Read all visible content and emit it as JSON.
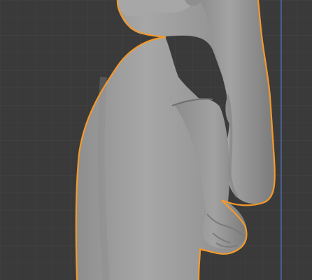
{
  "viewport": {
    "background": "#3a3a3a",
    "grid_color": "#444444",
    "axis_line_color": "#4d6fb3",
    "selection_outline_color": "#f39a2b",
    "mesh_base_color": "#9a9a9a",
    "icon_names": [
      "3d-viewport-icon",
      "selected-mesh-icon"
    ]
  }
}
